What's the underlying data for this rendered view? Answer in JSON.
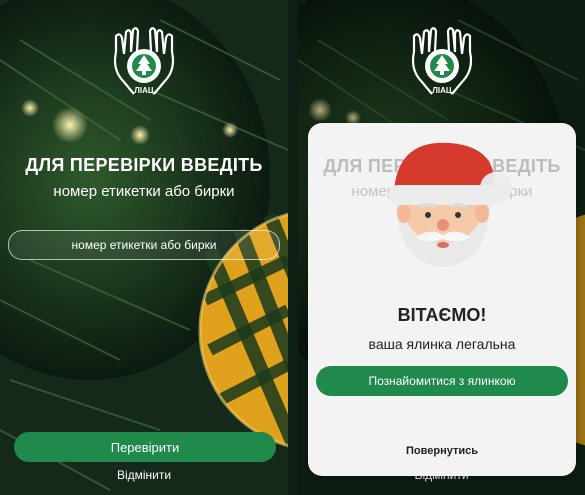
{
  "left_screen": {
    "title": "ДЛЯ ПЕРЕВІРКИ ВВЕДІТЬ",
    "subtitle": "номер етикетки або бирки",
    "input_placeholder": "номер етикетки або бирки",
    "check_button": "Перевірити",
    "cancel_link": "Відмінити",
    "logo_text": "ЛІАЦ"
  },
  "right_screen": {
    "background_title": "ДЛЯ ПЕРЕВІРКИ ВВЕДІТЬ",
    "background_subtitle": "номер етикетки або бирки",
    "cancel_link": "Відмінити",
    "logo_text": "ЛІАЦ",
    "modal": {
      "title": "ВІТАЄМО!",
      "subtitle": "ваша ялинка легальна",
      "primary_button": "Познайомитися з ялинкою",
      "secondary_button": "Повернутись"
    }
  },
  "colors": {
    "accent": "#1f8a4c",
    "modal_bg": "#f3f3f3"
  },
  "icons": [
    "hands-tree-logo-icon",
    "santa-icon"
  ]
}
